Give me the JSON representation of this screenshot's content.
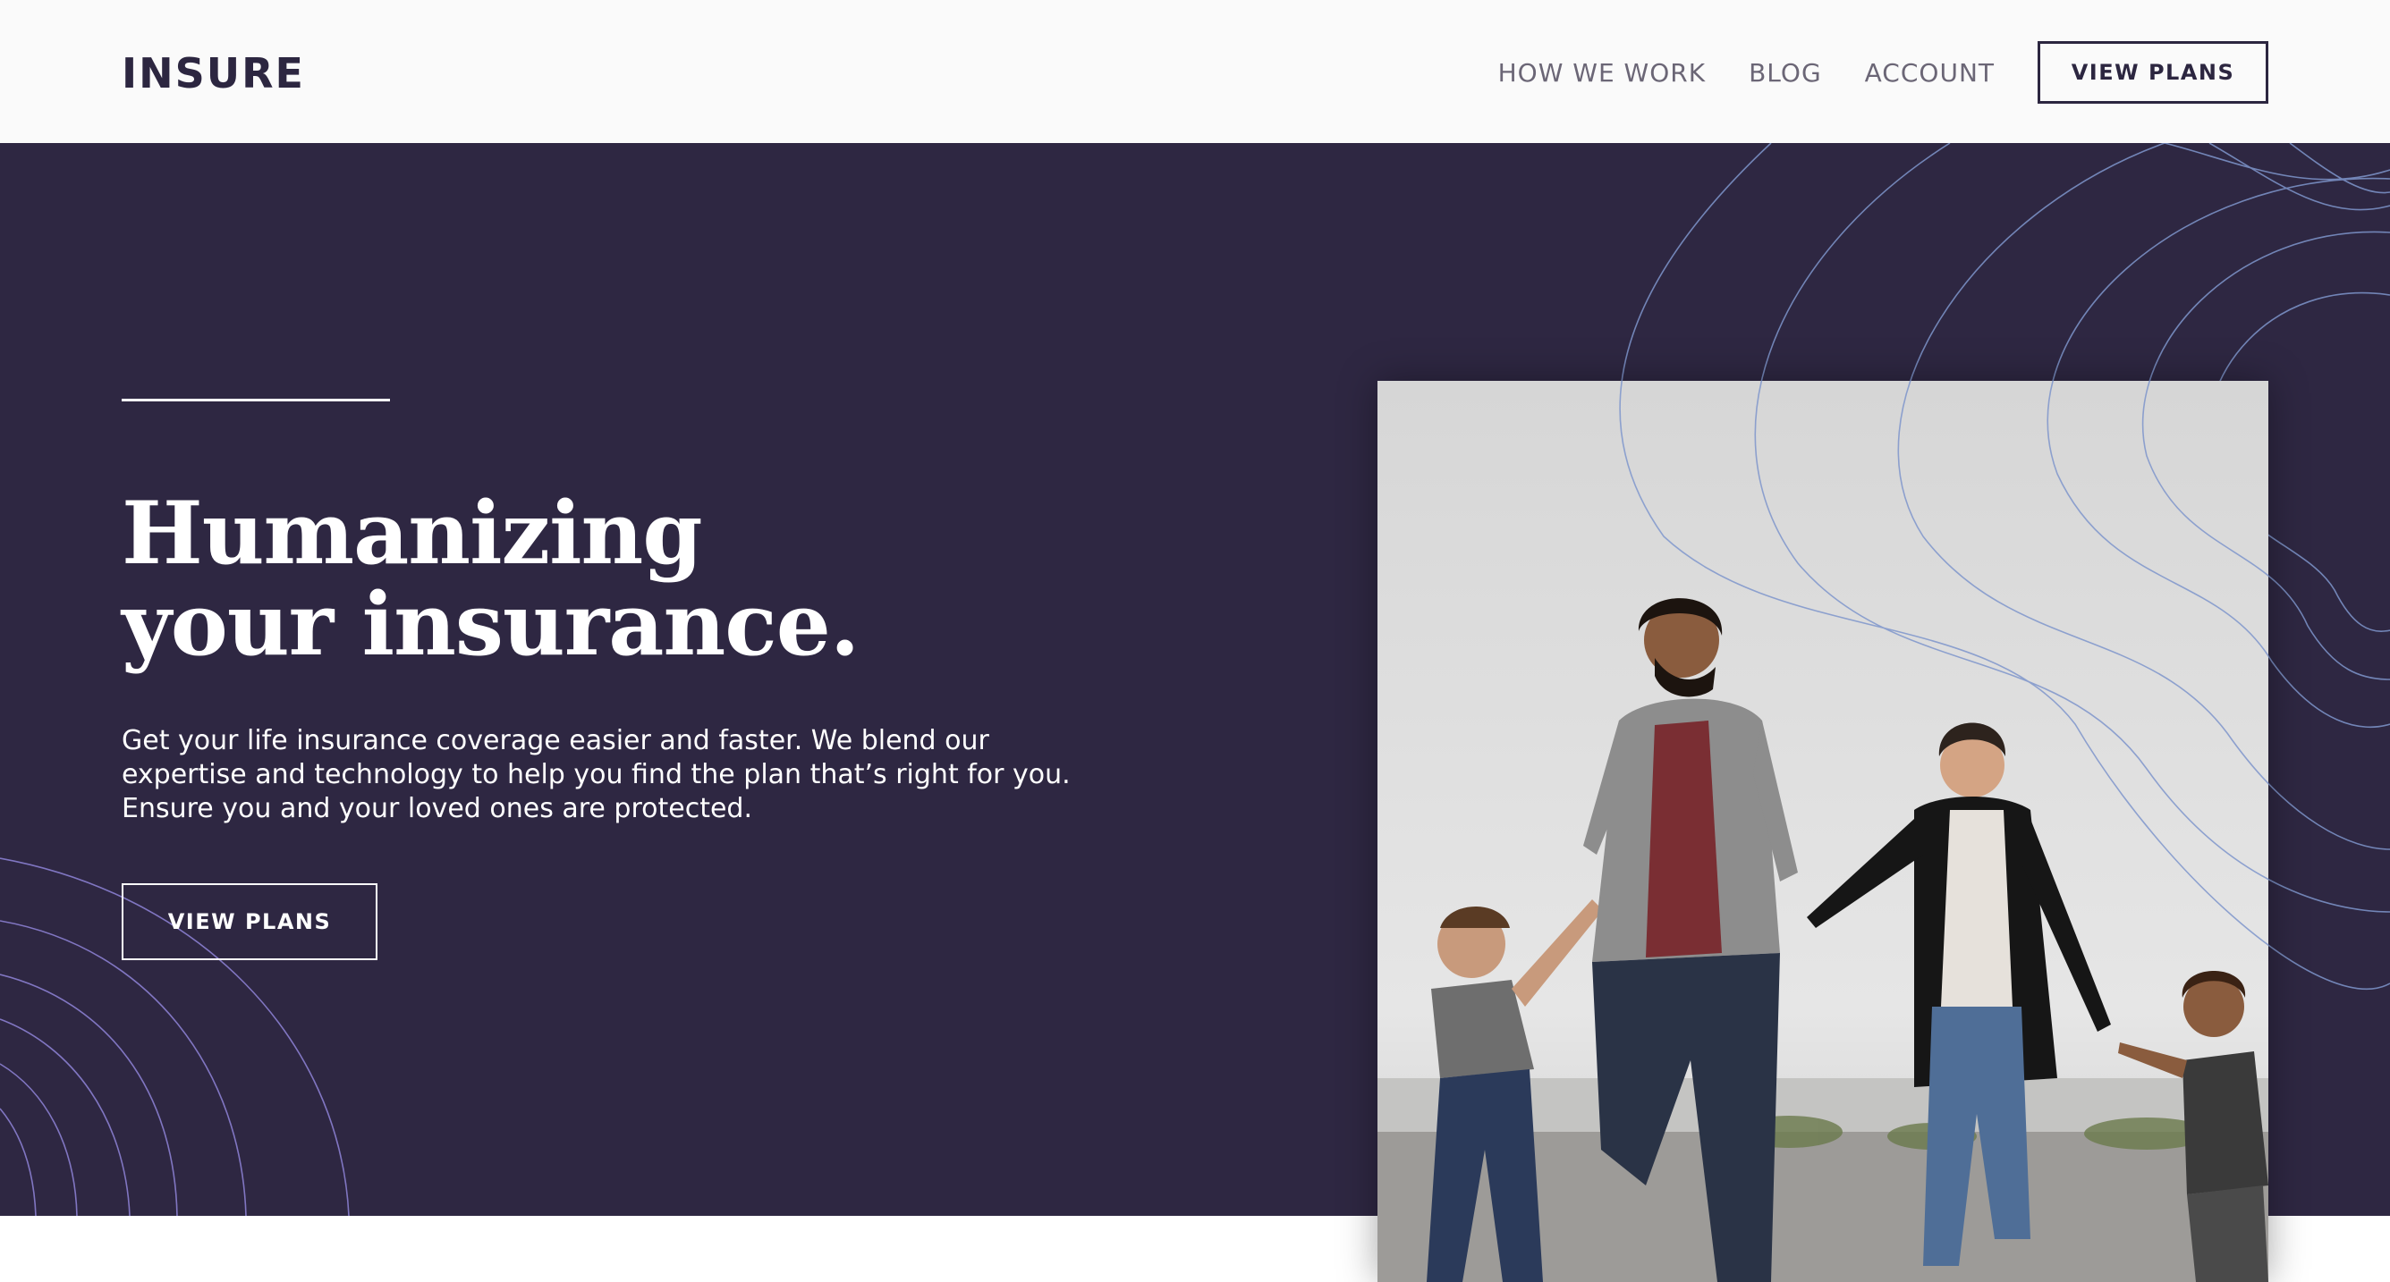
{
  "brand": {
    "logo_text": "INSURE"
  },
  "nav": {
    "items": [
      "HOW WE WORK",
      "BLOG",
      "ACCOUNT"
    ],
    "cta_label": "VIEW PLANS"
  },
  "hero": {
    "title_line1": "Humanizing",
    "title_line2": "your insurance.",
    "body": "Get your life insurance coverage easier and faster. We blend our expertise and technology to help you find the plan that’s right for you. Ensure you and your loved ones are protected.",
    "cta_label": "VIEW PLANS"
  },
  "colors": {
    "hero_bg": "#2e2742",
    "header_bg": "#fafafa",
    "nav_text": "#6b6676",
    "contour": "#8ea4d6"
  }
}
